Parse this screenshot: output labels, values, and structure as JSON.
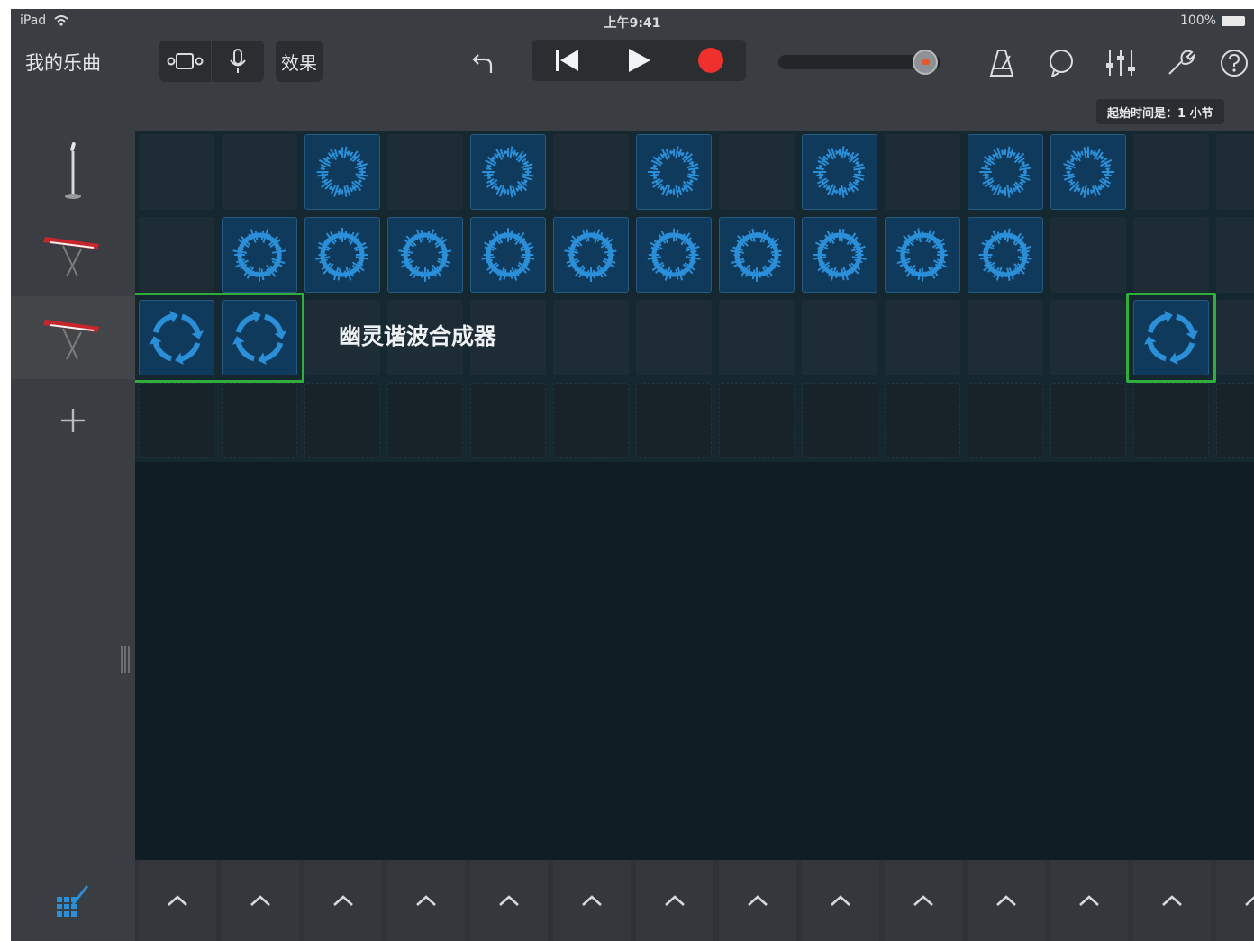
{
  "status_bar": {
    "device": "iPad",
    "time": "上午9:41",
    "battery": "100%"
  },
  "toolbar": {
    "song_title": "我的乐曲",
    "effects_label": "效果",
    "icons": [
      "remote-icon",
      "microphone-icon",
      "undo-icon",
      "rewind-icon",
      "play-icon",
      "record-icon",
      "metronome-icon",
      "loop-icon",
      "mixer-icon",
      "wrench-icon",
      "help-icon"
    ]
  },
  "master_volume": {
    "level": 0.98
  },
  "bar_info": "起始时间是：1 小节",
  "colors": {
    "region_fill": "#0f3a5c",
    "region_wave": "#2a8fd8",
    "selection": "#2fae3c",
    "record": "#f0302c"
  },
  "tracks": [
    {
      "instrument": "microphone-stand-icon",
      "cells": [
        0,
        0,
        1,
        0,
        1,
        0,
        1,
        0,
        1,
        0,
        1,
        1,
        0,
        0
      ]
    },
    {
      "instrument": "keyboard-icon",
      "cells": [
        0,
        1,
        1,
        1,
        1,
        1,
        1,
        1,
        1,
        1,
        1,
        0,
        0,
        0
      ]
    },
    {
      "instrument": "keyboard-icon",
      "cells": [
        2,
        2,
        0,
        0,
        0,
        0,
        0,
        0,
        0,
        0,
        0,
        0,
        2,
        0
      ]
    },
    {
      "instrument": "add-track-icon",
      "cells": [
        0,
        0,
        0,
        0,
        0,
        0,
        0,
        0,
        0,
        0,
        0,
        0,
        0,
        0
      ]
    }
  ],
  "selected_cell_label": "幽灵谐波合成器",
  "bottom": {
    "corner_icon": "cell-grid-edit-icon",
    "column_icon": "chevron-up-icon"
  }
}
